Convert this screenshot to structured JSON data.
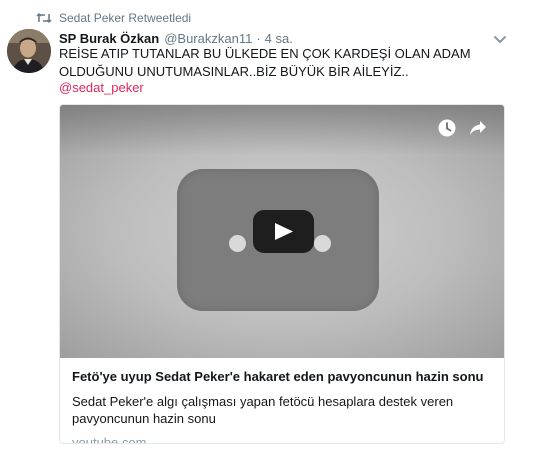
{
  "retweet": {
    "label": "Sedat Peker Retweetledi",
    "icon": "retweet-icon"
  },
  "tweet": {
    "author": {
      "name": "SP Burak Özkan",
      "handle": "@Burakzkan11",
      "avatar": "avatar"
    },
    "separator": "·",
    "time": "4 sa.",
    "text": "REİSE ATIP TUTANLAR BU ÜLKEDE EN ÇOK KARDEŞİ OLAN ADAM OLDUĞUNU UNUTUMASINLAR..BİZ BÜYÜK BİR AİLEYİZ..",
    "mention": "@sedat_peker",
    "menu_icon": "chevron-down-icon"
  },
  "card": {
    "title": "Fetö'ye uyup Sedat Peker'e hakaret eden pavyoncunun hazin sonu",
    "description": "Sedat Peker'e algı çalışması yapan fetöcü hesaplara destek veren pavyoncunun hazin sonu",
    "domain": "youtube.com",
    "media_icons": [
      "clock-icon",
      "share-icon",
      "play-icon"
    ]
  },
  "colors": {
    "text": "#14171a",
    "muted": "#657786",
    "mention": "#e0245e",
    "border": "#e1e8ed",
    "domain": "#8899a6"
  }
}
